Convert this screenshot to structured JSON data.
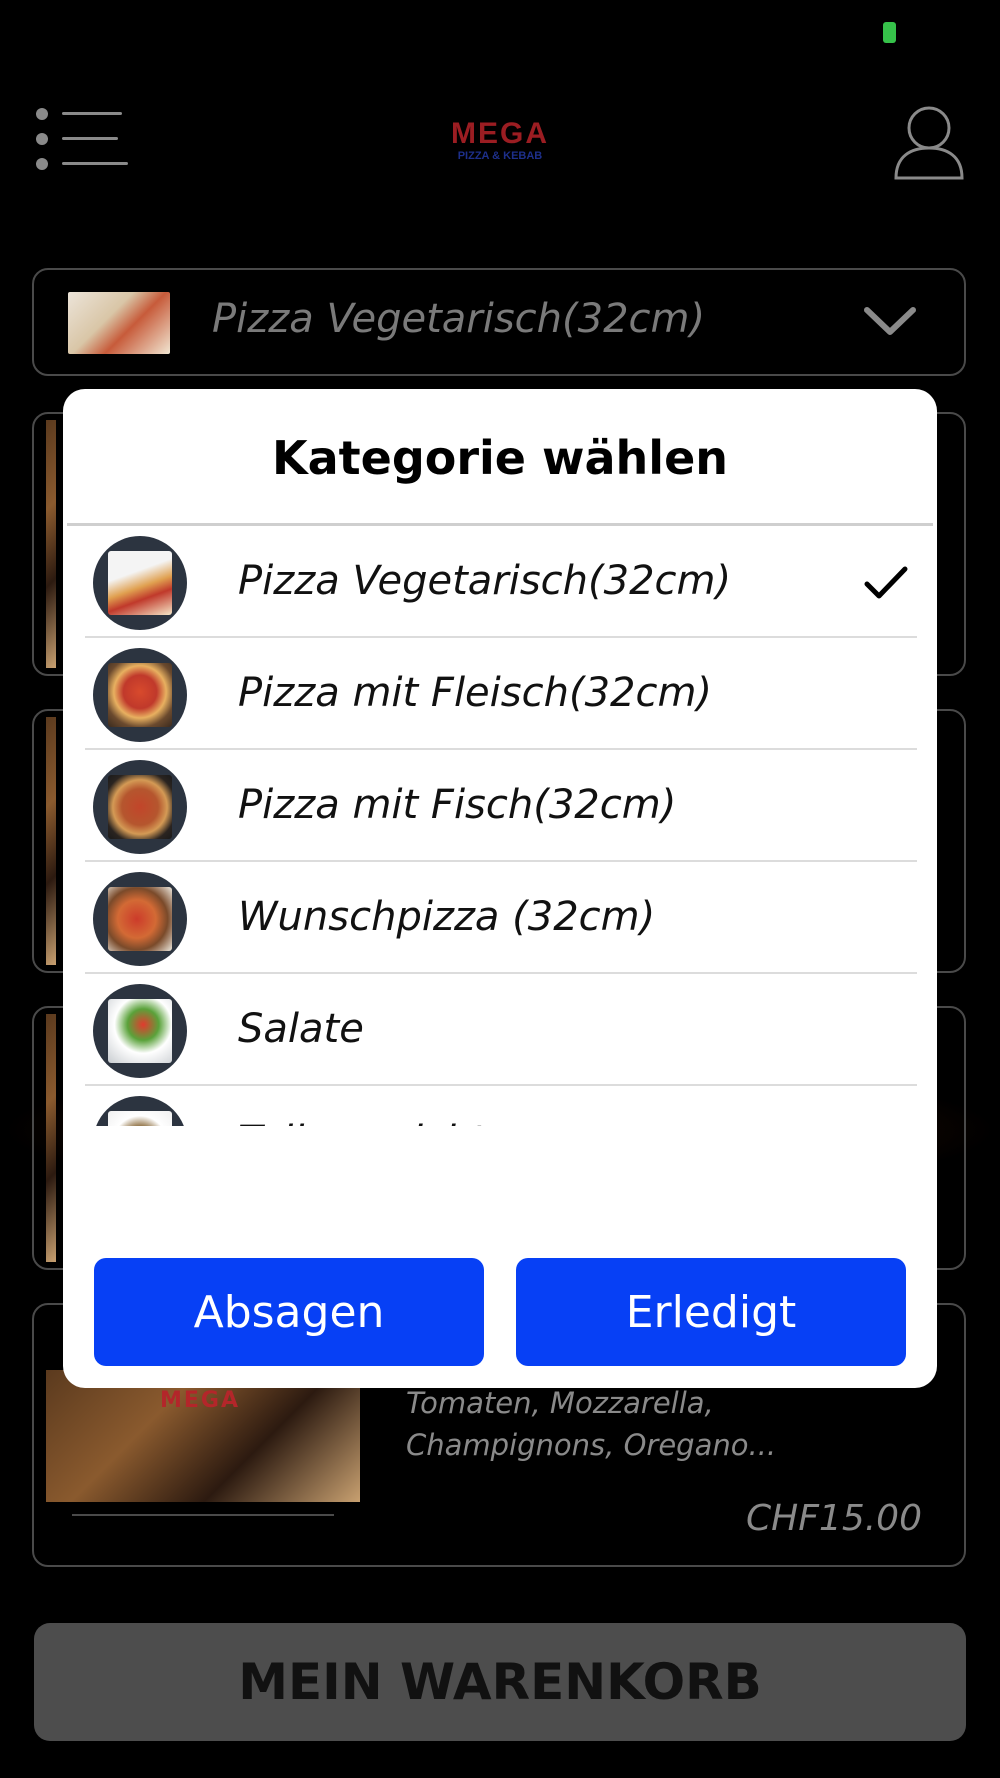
{
  "header": {
    "logo_main": "MEGA",
    "logo_sub": "PIZZA & KEBAB",
    "icons": {
      "menu": "menu-icon",
      "user": "user-icon"
    }
  },
  "category_select": {
    "selected_label": "Pizza Vegetarisch(32cm)",
    "icon": "chevron-down-icon"
  },
  "background_card": {
    "logo": "MEGA",
    "description": "Tomaten, Mozzarella, Champignons, Oregano...",
    "price": "CHF15.00"
  },
  "cart_button_label": "MEIN WARENKORB",
  "dialog": {
    "title": "Kategorie wählen",
    "items": [
      {
        "label": "Pizza Vegetarisch(32cm)",
        "selected": true
      },
      {
        "label": "Pizza mit Fleisch(32cm)",
        "selected": false
      },
      {
        "label": "Pizza mit Fisch(32cm)",
        "selected": false
      },
      {
        "label": "Wunschpizza (32cm)",
        "selected": false
      },
      {
        "label": "Salate",
        "selected": false
      },
      {
        "label": "Tellergerichte",
        "selected": false
      },
      {
        "label": "",
        "selected": false
      }
    ],
    "cancel_label": "Absagen",
    "done_label": "Erledigt"
  },
  "colors": {
    "accent_button": "#0740f5",
    "battery": "#36c24a",
    "logo_red": "#9b1d22"
  }
}
